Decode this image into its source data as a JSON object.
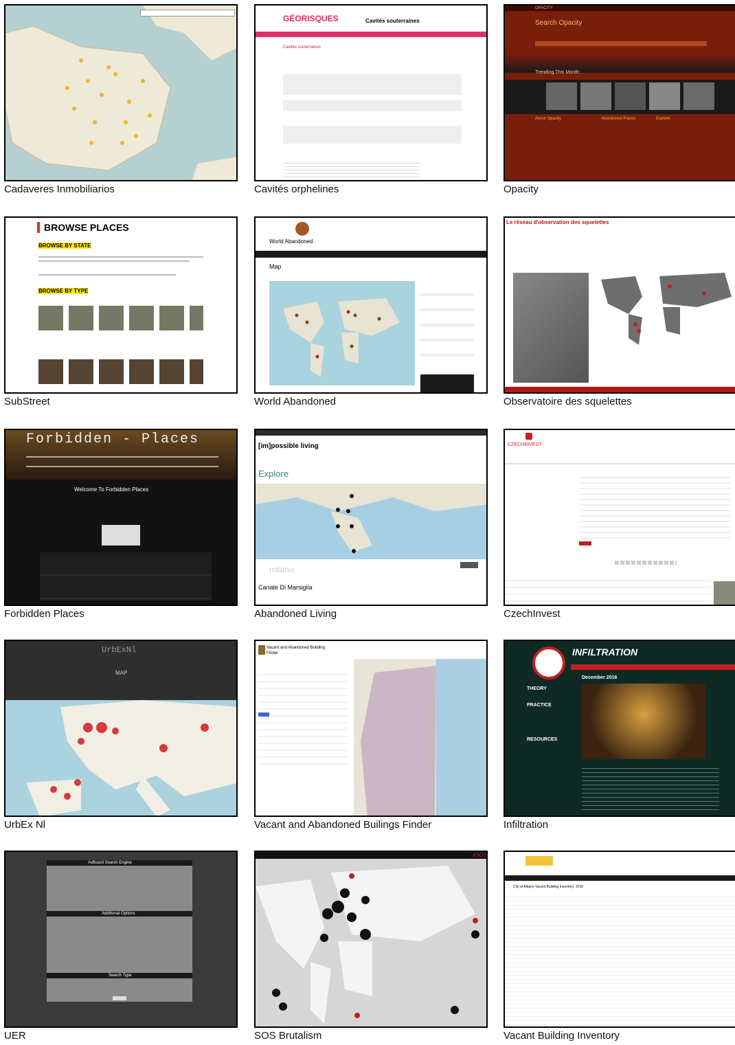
{
  "captions": [
    "Cadaveres Inmobiliarios",
    "Cavités orphelines",
    "Opacity",
    "SubStreet",
    "World Abandoned",
    "Observatoire des squelettes",
    "Forbidden Places",
    "Abandoned Living",
    "CzechInvest",
    "UrbEx Nl",
    "Vacant and Abandoned Builings Finder",
    "Infiltration",
    "UER",
    "SOS Brutalism",
    "Vacant Building Inventory"
  ],
  "shots": {
    "georisques": {
      "logo": "GÉORISQUES",
      "title": "Cavités souterraines",
      "heading": "Cavités souterraines"
    },
    "opacity": {
      "logo": "OPACITY",
      "search": "Search Opacity",
      "trending": "Trending This Month:",
      "about": "About Opacity",
      "places": "Abandoned Places",
      "explore": "Explore"
    },
    "substreet": {
      "title": "BROWSE PLACES",
      "by_state": "BROWSE BY STATE",
      "by_type": "BROWSE BY TYPE"
    },
    "worldab": {
      "logo": "World Abandoned",
      "map": "Map"
    },
    "observatoire": {
      "title": "Le réseau d'observation des squelettes"
    },
    "forbidden": {
      "title": "Forbidden - Places",
      "welcome": "Welcome To Forbidden Places"
    },
    "abliving": {
      "logo": "[im]possible living",
      "explore": "Explore",
      "place": "Canate Di Marsiglia",
      "query": "milano"
    },
    "czech": {
      "logo": "CZECHINVEST"
    },
    "urbex": {
      "logo": "UrbExNl",
      "map": "MAP"
    },
    "vacant": {
      "title": "Vacant and Abandoned Building Finder"
    },
    "infiltration": {
      "logo": "INFILTRATION",
      "date": "December 2016",
      "theory": "THEORY",
      "practice": "PRACTICE",
      "resources": "RESOURCES"
    },
    "uer": {
      "title": "AvBoard Search Engine",
      "options": "Additional Options",
      "type": "Search Type"
    },
    "sos": {
      "tag": "#SOS"
    },
    "inventory": {
      "title": "City of Albany Vacant Building Inventory: 2015"
    }
  }
}
